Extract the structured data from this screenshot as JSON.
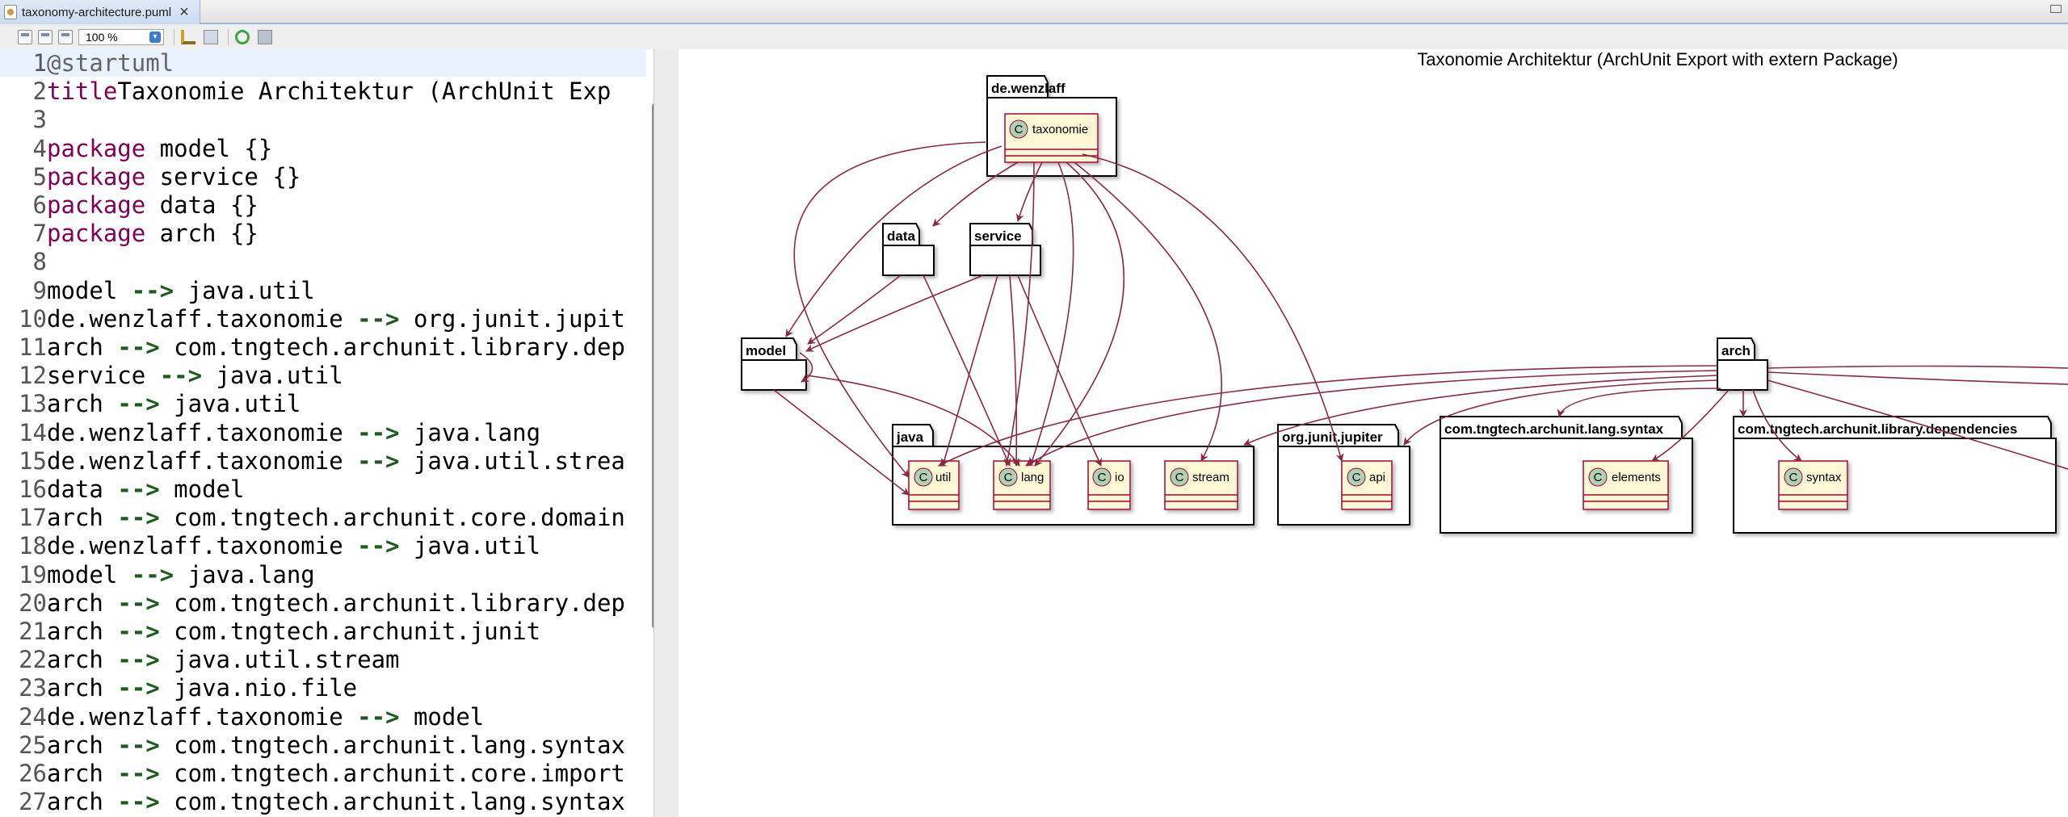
{
  "tab": {
    "title": "taxonomy-architecture.puml"
  },
  "toolbar": {
    "zoom": "100 %"
  },
  "editor": {
    "lines": [
      {
        "n": "1",
        "parts": [
          [
            "ann",
            "@startuml"
          ]
        ]
      },
      {
        "n": "2",
        "parts": [
          [
            "kw",
            "title"
          ],
          [
            "",
            "Taxonomie Architektur (ArchUnit Exp"
          ]
        ]
      },
      {
        "n": "3",
        "parts": []
      },
      {
        "n": "4",
        "parts": [
          [
            "kw",
            "package"
          ],
          [
            "",
            " model {}"
          ]
        ]
      },
      {
        "n": "5",
        "parts": [
          [
            "kw",
            "package"
          ],
          [
            "",
            " service {}"
          ]
        ]
      },
      {
        "n": "6",
        "parts": [
          [
            "kw",
            "package"
          ],
          [
            "",
            " data {}"
          ]
        ]
      },
      {
        "n": "7",
        "parts": [
          [
            "kw",
            "package"
          ],
          [
            "",
            " arch {}"
          ]
        ]
      },
      {
        "n": "8",
        "parts": []
      },
      {
        "n": "9",
        "parts": [
          [
            "",
            "model "
          ],
          [
            "ar",
            "-->"
          ],
          [
            "",
            " java.util"
          ]
        ]
      },
      {
        "n": "10",
        "parts": [
          [
            "",
            "de.wenzlaff.taxonomie "
          ],
          [
            "ar",
            "-->"
          ],
          [
            "",
            " org.junit.jupit"
          ]
        ]
      },
      {
        "n": "11",
        "parts": [
          [
            "",
            "arch "
          ],
          [
            "ar",
            "-->"
          ],
          [
            "",
            " com.tngtech.archunit.library.dep"
          ]
        ]
      },
      {
        "n": "12",
        "parts": [
          [
            "",
            "service "
          ],
          [
            "ar",
            "-->"
          ],
          [
            "",
            " java.util"
          ]
        ]
      },
      {
        "n": "13",
        "parts": [
          [
            "",
            "arch "
          ],
          [
            "ar",
            "-->"
          ],
          [
            "",
            " java.util"
          ]
        ]
      },
      {
        "n": "14",
        "parts": [
          [
            "",
            "de.wenzlaff.taxonomie "
          ],
          [
            "ar",
            "-->"
          ],
          [
            "",
            " java.lang"
          ]
        ]
      },
      {
        "n": "15",
        "parts": [
          [
            "",
            "de.wenzlaff.taxonomie "
          ],
          [
            "ar",
            "-->"
          ],
          [
            "",
            " java.util.strea"
          ]
        ]
      },
      {
        "n": "16",
        "parts": [
          [
            "",
            "data "
          ],
          [
            "ar",
            "-->"
          ],
          [
            "",
            " model"
          ]
        ]
      },
      {
        "n": "17",
        "parts": [
          [
            "",
            "arch "
          ],
          [
            "ar",
            "-->"
          ],
          [
            "",
            " com.tngtech.archunit.core.domain"
          ]
        ]
      },
      {
        "n": "18",
        "parts": [
          [
            "",
            "de.wenzlaff.taxonomie "
          ],
          [
            "ar",
            "-->"
          ],
          [
            "",
            " java.util"
          ]
        ]
      },
      {
        "n": "19",
        "parts": [
          [
            "",
            "model "
          ],
          [
            "ar",
            "-->"
          ],
          [
            "",
            " java.lang"
          ]
        ]
      },
      {
        "n": "20",
        "parts": [
          [
            "",
            "arch "
          ],
          [
            "ar",
            "-->"
          ],
          [
            "",
            " com.tngtech.archunit.library.dep"
          ]
        ]
      },
      {
        "n": "21",
        "parts": [
          [
            "",
            "arch "
          ],
          [
            "ar",
            "-->"
          ],
          [
            "",
            " com.tngtech.archunit.junit"
          ]
        ]
      },
      {
        "n": "22",
        "parts": [
          [
            "",
            "arch "
          ],
          [
            "ar",
            "-->"
          ],
          [
            "",
            " java.util.stream"
          ]
        ]
      },
      {
        "n": "23",
        "parts": [
          [
            "",
            "arch "
          ],
          [
            "ar",
            "-->"
          ],
          [
            "",
            " java.nio.file"
          ]
        ]
      },
      {
        "n": "24",
        "parts": [
          [
            "",
            "de.wenzlaff.taxonomie "
          ],
          [
            "ar",
            "-->"
          ],
          [
            "",
            " model"
          ]
        ]
      },
      {
        "n": "25",
        "parts": [
          [
            "",
            "arch "
          ],
          [
            "ar",
            "-->"
          ],
          [
            "",
            " com.tngtech.archunit.lang.syntax"
          ]
        ]
      },
      {
        "n": "26",
        "parts": [
          [
            "",
            "arch "
          ],
          [
            "ar",
            "-->"
          ],
          [
            "",
            " com.tngtech.archunit.core.import"
          ]
        ]
      },
      {
        "n": "27",
        "parts": [
          [
            "",
            "arch "
          ],
          [
            "ar",
            "-->"
          ],
          [
            "",
            " com.tngtech.archunit.lang.syntax"
          ]
        ]
      }
    ]
  },
  "diagram": {
    "title": "Taxonomie Architektur (ArchUnit Export with extern Package)",
    "packages": {
      "wenzlaff": "de.wenzlaff",
      "data": "data",
      "service": "service",
      "model": "model",
      "java": "java",
      "junit": "org.junit.jupiter",
      "syntax": "com.tngtech.archunit.lang.syntax",
      "deps": "com.tngtech.archunit.library.dependencies",
      "arch": "arch"
    },
    "classes": {
      "taxonomie": "taxonomie",
      "util": "util",
      "lang": "lang",
      "io": "io",
      "stream": "stream",
      "api": "api",
      "elements": "elements",
      "syntax_cls": "syntax",
      "class_glyph": "C"
    },
    "colors": {
      "arrow": "#8b2942",
      "class_fill": "#fef7d5",
      "class_border": "#a80036",
      "circle": "#add1b2"
    }
  }
}
